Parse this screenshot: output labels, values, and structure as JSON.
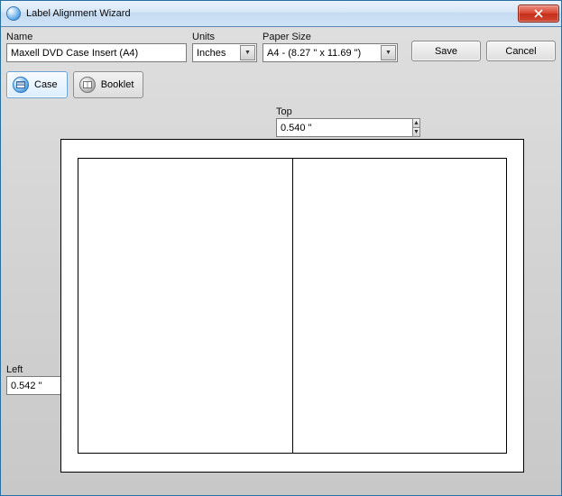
{
  "window": {
    "title": "Label Alignment Wizard"
  },
  "labels": {
    "name": "Name",
    "units": "Units",
    "paper": "Paper Size",
    "top": "Top",
    "left": "Left"
  },
  "fields": {
    "name_value": "Maxell DVD Case Insert (A4)",
    "units_value": "Inches",
    "paper_value": "A4 - (8.27 \" x 11.69 \")",
    "top_value": "0.540 \"",
    "left_value": "0.542 \""
  },
  "buttons": {
    "save": "Save",
    "cancel": "Cancel"
  },
  "tabs": {
    "case": "Case",
    "booklet": "Booklet"
  }
}
